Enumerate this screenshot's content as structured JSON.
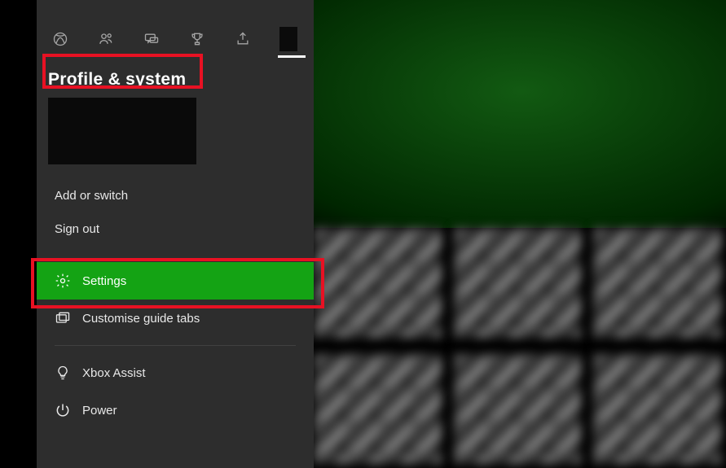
{
  "guide": {
    "title": "Profile & system",
    "tabs": [
      {
        "name": "xbox"
      },
      {
        "name": "people"
      },
      {
        "name": "chat"
      },
      {
        "name": "achievements"
      },
      {
        "name": "share"
      },
      {
        "name": "profile",
        "active": true
      }
    ],
    "account_actions": {
      "add_or_switch": "Add or switch",
      "sign_out": "Sign out"
    },
    "menu": {
      "settings": "Settings",
      "customise_tabs": "Customise guide tabs",
      "xbox_assist": "Xbox Assist",
      "power": "Power"
    },
    "selected": "settings"
  },
  "colors": {
    "accent": "#14a314",
    "annotate": "#e81123",
    "panel": "#2d2d2d"
  }
}
